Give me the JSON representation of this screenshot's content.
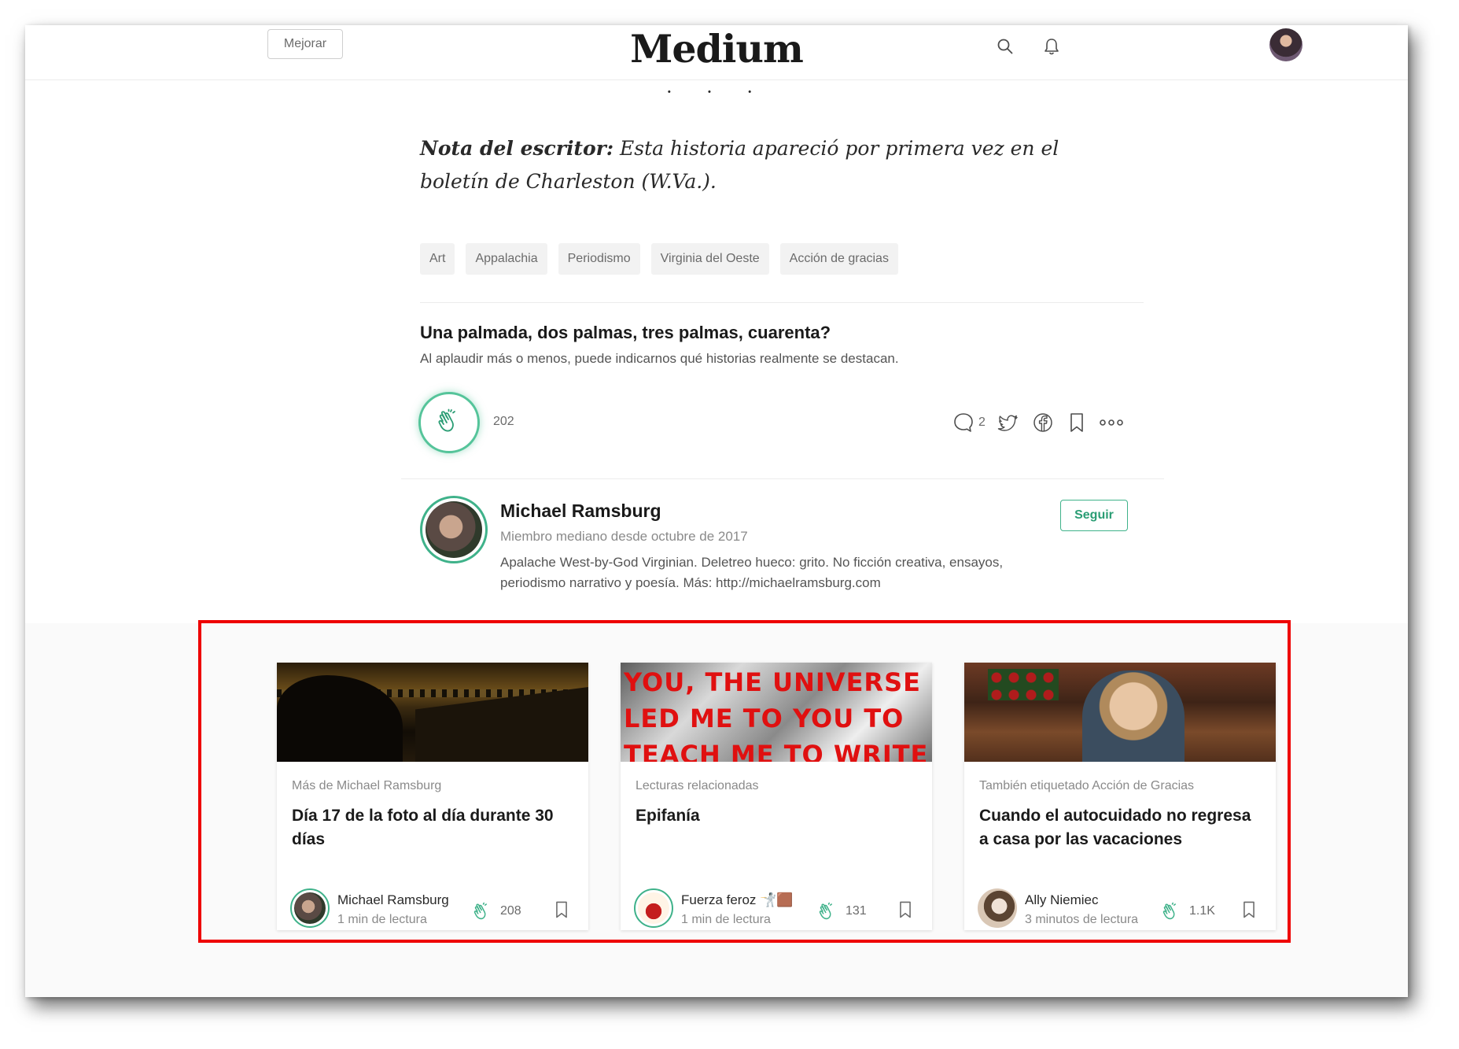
{
  "topbar": {
    "upgrade_label": "Mejorar",
    "logo": "Medium",
    "search_icon": "search-icon",
    "bell_icon": "bell-icon"
  },
  "separator": "· · ·",
  "note": {
    "label": "Nota del escritor:",
    "text": " Esta historia apareció por primera vez en el boletín de Charleston (W.Va.)."
  },
  "tags": [
    "Art",
    "Appalachia",
    "Periodismo",
    "Virginia del Oeste",
    "Acción de gracias"
  ],
  "clap_section": {
    "title": "Una palmada, dos palmas, tres palmas, cuarenta?",
    "subtitle": "Al aplaudir más o menos, puede indicarnos qué historias realmente se destacan.",
    "clap_count": "202",
    "response_count": "2"
  },
  "author": {
    "name": "Michael Ramsburg",
    "since": "Miembro mediano desde octubre de 2017",
    "bio": "Apalache West-by-God Virginian. Deletreo hueco: grito. No ficción creativa, ensayos, periodismo narrativo y poesía. Más: http://michaelramsburg.com",
    "follow_label": "Seguir"
  },
  "accent_color": "#3fb28a",
  "highlight_color": "#ee0000",
  "cards": [
    {
      "category": "Más de Michael Ramsburg",
      "title": "Día 17 de la foto al día durante 30 días",
      "author": "Michael Ramsburg",
      "read_time": "1 min de lectura",
      "claps": "208"
    },
    {
      "category": "Lecturas relacionadas",
      "title": "Epifanía",
      "image_text": "YOU, THE UNIVERSE LED ME TO YOU TO TEACH ME TO WRITE LOVE POEMS❤",
      "author": "Fuerza feroz 🤺🟫",
      "read_time": "1 min de lectura",
      "claps": "131"
    },
    {
      "category": "También etiquetado Acción de Gracias",
      "title": "Cuando el autocuidado no regresa a casa por las vacaciones",
      "author": "Ally Niemiec",
      "read_time": "3 minutos de lectura",
      "claps": "1.1K"
    }
  ]
}
